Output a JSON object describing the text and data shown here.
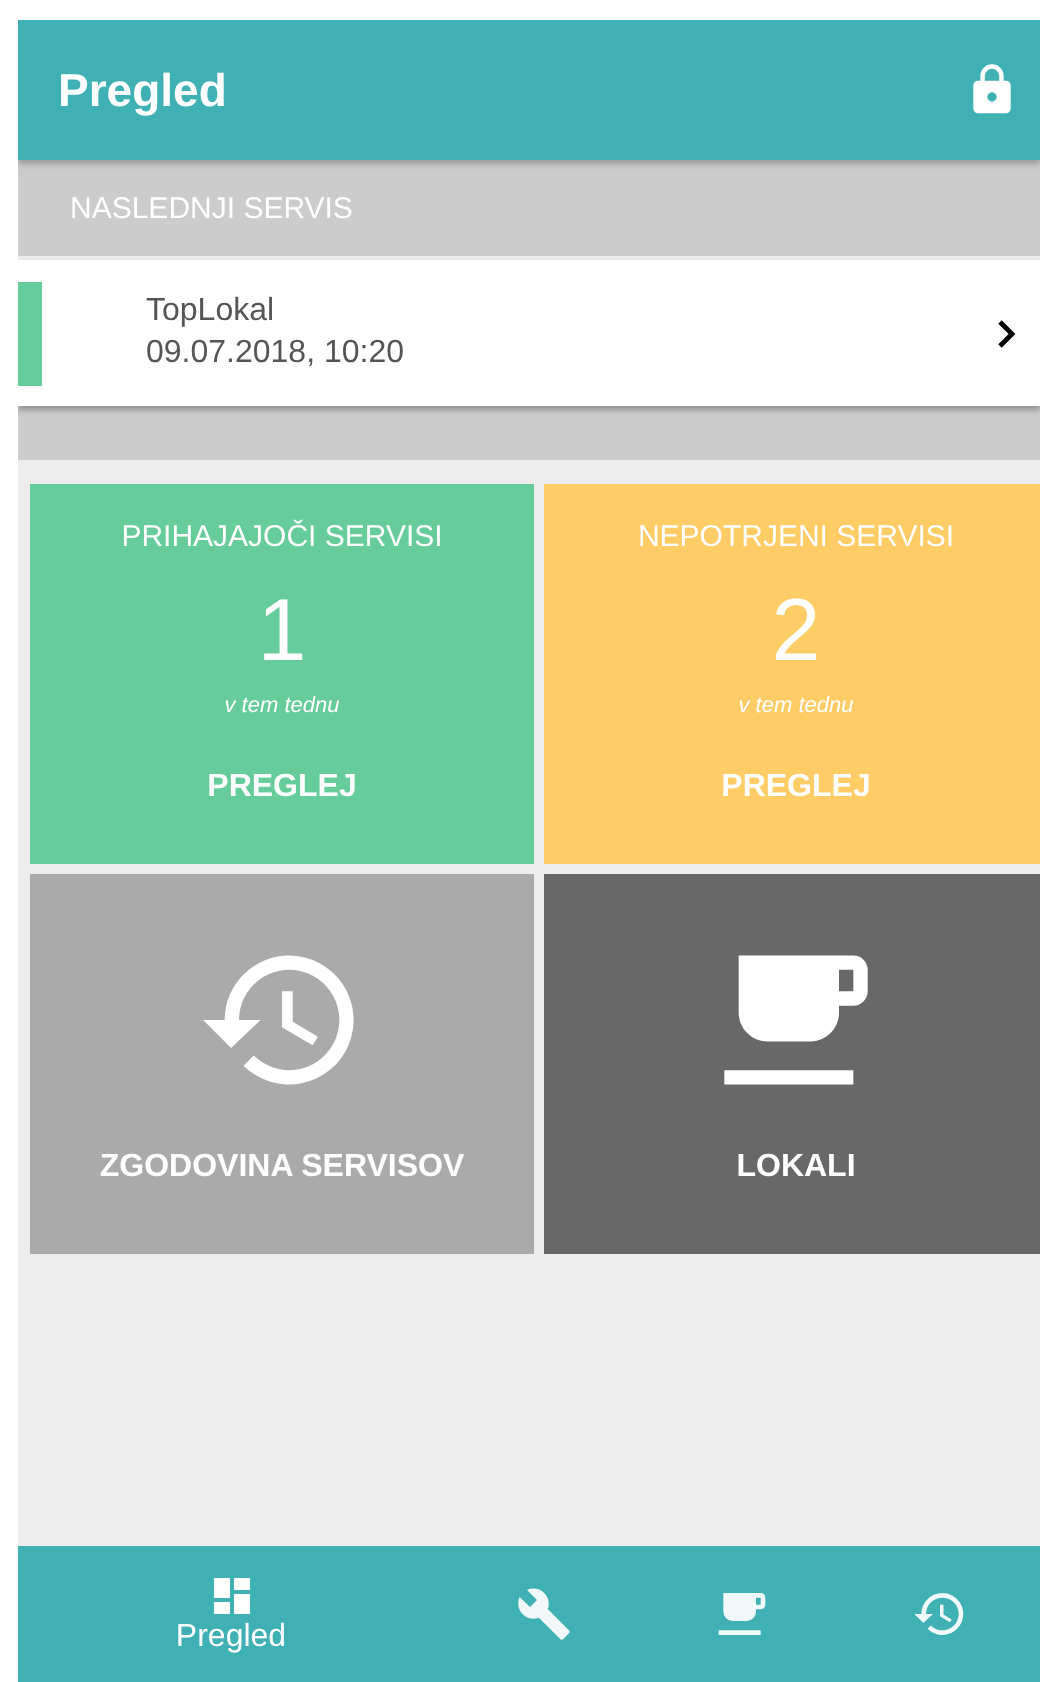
{
  "app_bar": {
    "title": "Pregled"
  },
  "next_service": {
    "heading": "NASLEDNJI SERVIS",
    "name": "TopLokal",
    "datetime": "09.07.2018, 10:20",
    "color": "#66cc99"
  },
  "tiles": [
    {
      "kind": "counter",
      "title": "PRIHAJAJOČI SERVISI",
      "count": "1",
      "caption": "v tem tednu",
      "action": "PREGLEJ",
      "color": "#66cc99"
    },
    {
      "kind": "counter",
      "title": "NEPOTRJENI SERVISI",
      "count": "2",
      "caption": "v tem tednu",
      "action": "PREGLEJ",
      "color": "#ffcc66"
    },
    {
      "kind": "history",
      "label": "ZGODOVINA SERVISOV",
      "color": "#aaaaaa"
    },
    {
      "kind": "venues",
      "label": "LOKALI",
      "color": "#686868"
    }
  ],
  "bottom_nav": [
    {
      "kind": "overview",
      "label": "Pregled",
      "selected": true
    },
    {
      "kind": "service",
      "selected": false
    },
    {
      "kind": "venues",
      "selected": false
    },
    {
      "kind": "history",
      "selected": false
    }
  ]
}
